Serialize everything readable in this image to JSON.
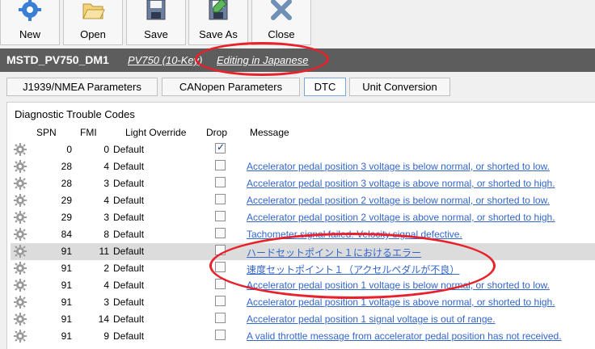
{
  "toolbar": {
    "new_label": "New",
    "open_label": "Open",
    "save_label": "Save",
    "save_as_label": "Save As",
    "close_label": "Close"
  },
  "titlebar": {
    "name": "MSTD_PV750_DM1",
    "model": "PV750 (10-Key)",
    "language_mode": "Editing in Japanese"
  },
  "tabs": [
    {
      "label": "J1939/NMEA Parameters"
    },
    {
      "label": "CANopen Parameters"
    },
    {
      "label": "DTC"
    },
    {
      "label": "Unit Conversion"
    }
  ],
  "dtc": {
    "title": "Diagnostic Trouble Codes",
    "columns": {
      "spn": "SPN",
      "fmi": "FMI",
      "light": "Light Override",
      "drop": "Drop",
      "message": "Message"
    },
    "rows": [
      {
        "spn": "0",
        "fmi": "0",
        "light": "Default",
        "drop": true,
        "message": ""
      },
      {
        "spn": "28",
        "fmi": "4",
        "light": "Default",
        "drop": false,
        "message": "Accelerator pedal position 3 voltage is below normal, or shorted to low."
      },
      {
        "spn": "28",
        "fmi": "3",
        "light": "Default",
        "drop": false,
        "message": "Accelerator pedal position 3 voltage is above normal, or shorted to high."
      },
      {
        "spn": "29",
        "fmi": "4",
        "light": "Default",
        "drop": false,
        "message": "Accelerator pedal position 2 voltage is below normal, or shorted to low."
      },
      {
        "spn": "29",
        "fmi": "3",
        "light": "Default",
        "drop": false,
        "message": "Accelerator pedal position 2 voltage is above normal, or shorted to high."
      },
      {
        "spn": "84",
        "fmi": "8",
        "light": "Default",
        "drop": false,
        "message": "Tachometer signal failed.  Velocity signal defective."
      },
      {
        "spn": "91",
        "fmi": "11",
        "light": "Default",
        "drop": false,
        "message": "ハードセットポイント１におけるエラー"
      },
      {
        "spn": "91",
        "fmi": "2",
        "light": "Default",
        "drop": false,
        "message": "速度セットポイント１（アクセルペダルが不良）"
      },
      {
        "spn": "91",
        "fmi": "4",
        "light": "Default",
        "drop": false,
        "message": "Accelerator pedal position 1 voltage is below normal, or shorted to low."
      },
      {
        "spn": "91",
        "fmi": "3",
        "light": "Default",
        "drop": false,
        "message": "Accelerator pedal position 1 voltage is above normal, or shorted to high."
      },
      {
        "spn": "91",
        "fmi": "14",
        "light": "Default",
        "drop": false,
        "message": "Accelerator pedal position 1 signal voltage is out of range."
      },
      {
        "spn": "91",
        "fmi": "9",
        "light": "Default",
        "drop": false,
        "message": "A valid throttle message from accelerator pedal position has not received."
      }
    ]
  },
  "colors": {
    "titlebar_bg": "#5d5d5d",
    "link": "#3366cc",
    "highlight_oval": "#e8212b",
    "selected_row": "#dcdcdc"
  },
  "icons": {
    "new": "gear-icon",
    "open": "folder-open-icon",
    "save": "floppy-disk-icon",
    "save_as": "floppy-disk-pencil-icon",
    "close": "close-x-icon",
    "row": "gear-icon"
  }
}
